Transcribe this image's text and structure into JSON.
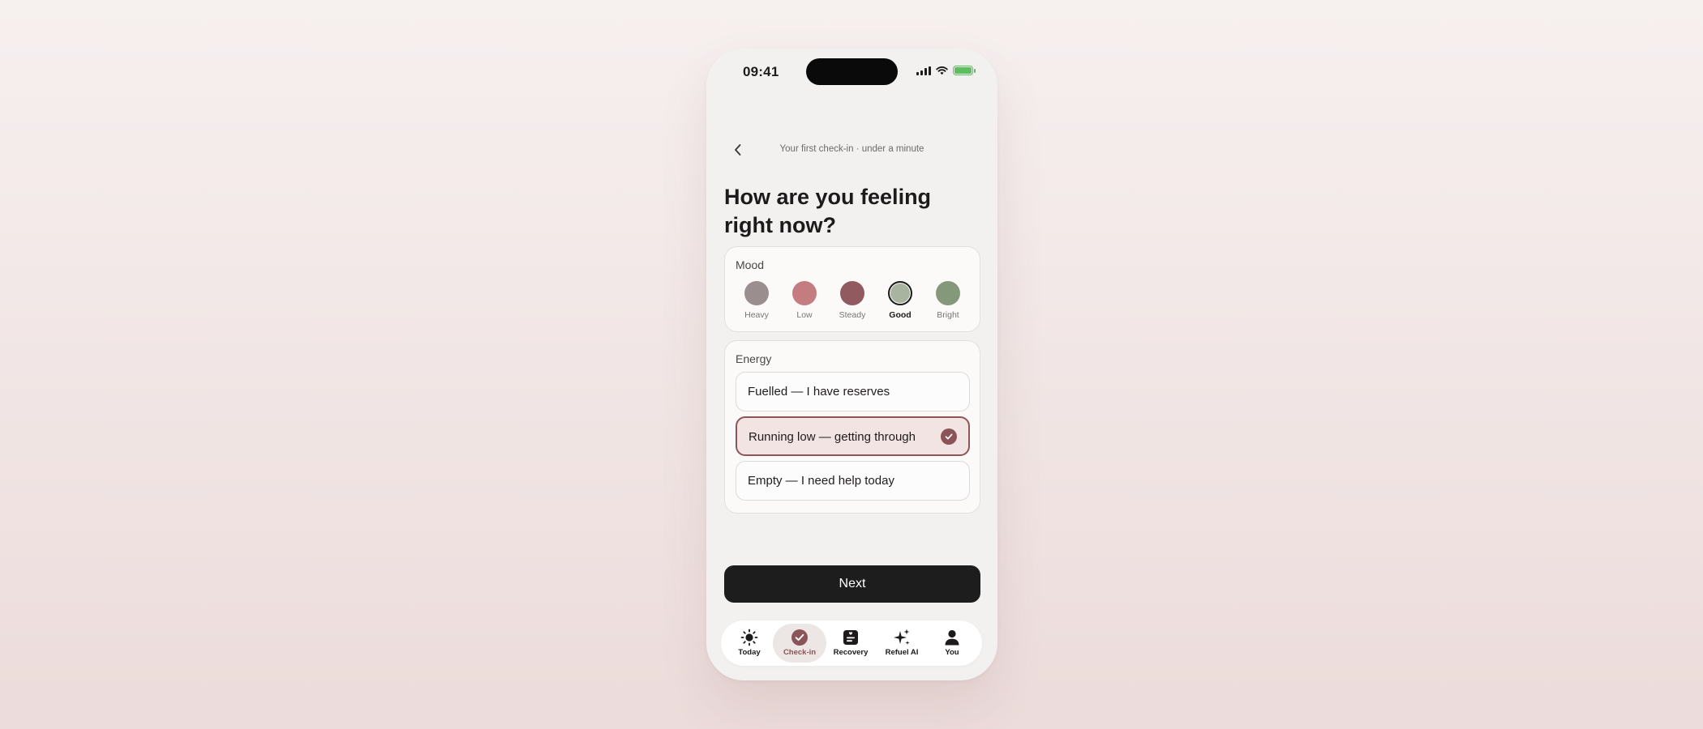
{
  "status_bar": {
    "time": "09:41"
  },
  "header": {
    "caption": "Your first check-in · under a minute"
  },
  "title": "How are you feeling right now?",
  "mood": {
    "label": "Mood",
    "selected": "Good",
    "options": [
      {
        "label": "Heavy",
        "color": "#9a8e8e"
      },
      {
        "label": "Low",
        "color": "#c47c80"
      },
      {
        "label": "Steady",
        "color": "#905a5e"
      },
      {
        "label": "Good",
        "color": "#a9b4a0"
      },
      {
        "label": "Bright",
        "color": "#84997a"
      }
    ]
  },
  "energy": {
    "label": "Energy",
    "selected": "Running low — getting through",
    "options": [
      {
        "label": "Fuelled — I have reserves"
      },
      {
        "label": "Running low — getting through"
      },
      {
        "label": "Empty — I need help today"
      }
    ]
  },
  "next_label": "Next",
  "tabs": [
    {
      "label": "Today",
      "icon": "sun-icon"
    },
    {
      "label": "Check-in",
      "icon": "check-circle-icon"
    },
    {
      "label": "Recovery",
      "icon": "journal-icon"
    },
    {
      "label": "Refuel AI",
      "icon": "sparkle-icon"
    },
    {
      "label": "You",
      "icon": "person-icon"
    }
  ],
  "active_tab": "Check-in",
  "colors": {
    "accent": "#8a5458",
    "primary_button": "#1e1d1d",
    "battery": "#5bbf5d"
  }
}
